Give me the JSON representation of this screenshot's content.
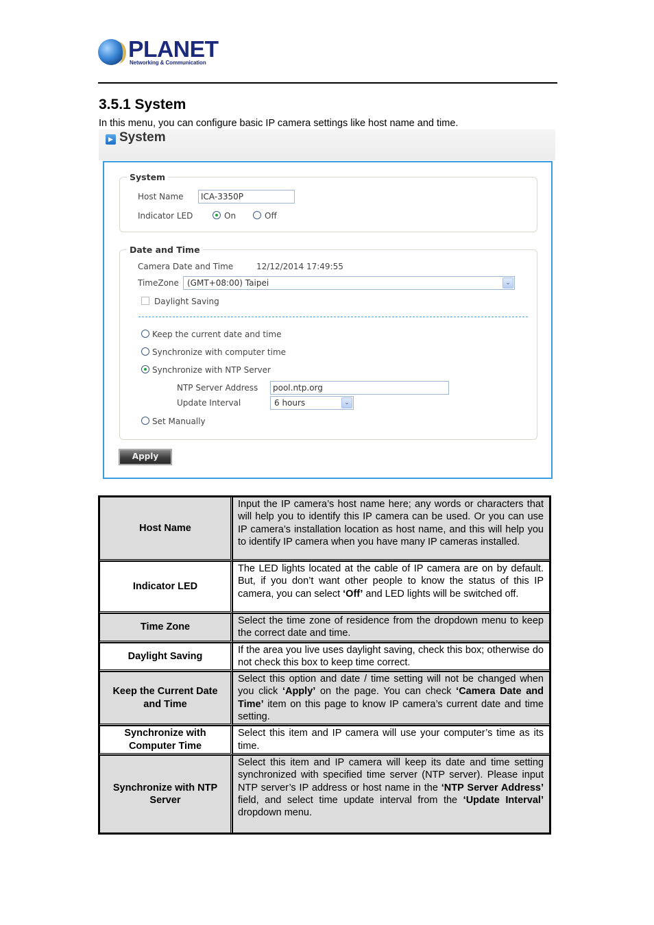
{
  "header": {
    "logo_word": "PLANET",
    "logo_tagline": "Networking & Communication"
  },
  "section": {
    "title": "3.5.1 System",
    "intro": "In this menu, you can configure basic IP camera settings like host name and time."
  },
  "panel": {
    "title": "System",
    "system_group": {
      "legend": "System",
      "host_name_label": "Host Name",
      "host_name_value": "ICA-3350P",
      "indicator_led_label": "Indicator LED",
      "led_options": [
        {
          "label": "On",
          "selected": true
        },
        {
          "label": "Off",
          "selected": false
        }
      ]
    },
    "date_time_group": {
      "legend": "Date and Time",
      "camera_date_label": "Camera Date and Time",
      "camera_date_value": "12/12/2014 17:49:55",
      "timezone_label": "TimeZone",
      "timezone_value": "(GMT+08:00) Taipei",
      "daylight_saving_label": "Daylight Saving",
      "daylight_saving_checked": false,
      "mode_options": [
        {
          "label": "Keep the current date and time",
          "selected": false
        },
        {
          "label": "Synchronize with computer time",
          "selected": false
        },
        {
          "label": "Synchronize with NTP Server",
          "selected": true
        },
        {
          "label": "Set Manually",
          "selected": false
        }
      ],
      "ntp_server_label": "NTP Server Address",
      "ntp_server_value": "pool.ntp.org",
      "update_interval_label": "Update Interval",
      "update_interval_value": "6 hours"
    },
    "apply_label": "Apply"
  },
  "table": {
    "rows": [
      {
        "key": "Host Name",
        "shaded": true,
        "parts": [
          {
            "t": "Input the IP camera’s host name here; any words or characters that will help you to identify this IP camera can be used. Or you can use IP camera’s installation location as host name, and this will help you to identify IP camera when you have many IP cameras installed."
          }
        ]
      },
      {
        "key": "Indicator LED",
        "shaded": false,
        "parts": [
          {
            "t": "The LED lights located at the cable of IP camera are on by default. But, if you don’t want other people to know the status of this IP camera, you can select "
          },
          {
            "t": "‘Off’",
            "b": true
          },
          {
            "t": " and LED lights will be switched off."
          }
        ]
      },
      {
        "key": "Time Zone",
        "shaded": true,
        "parts": [
          {
            "t": "Select the time zone of residence from the dropdown menu to keep the correct date and time."
          }
        ]
      },
      {
        "key": "Daylight Saving",
        "shaded": false,
        "parts": [
          {
            "t": "If the area you live uses daylight saving, check this box; otherwise do not check this box to keep time correct."
          }
        ]
      },
      {
        "key": "Keep the Current Date and Time",
        "shaded": true,
        "parts": [
          {
            "t": "Select this option and date / time setting will not be changed when you click "
          },
          {
            "t": "‘Apply’",
            "b": true
          },
          {
            "t": " on the page. You can check "
          },
          {
            "t": "‘Camera Date and Time’",
            "b": true
          },
          {
            "t": " item on this page to know IP camera’s current date and time setting."
          }
        ]
      },
      {
        "key": "Synchronize with Computer Time",
        "shaded": false,
        "parts": [
          {
            "t": "Select this item and IP camera will use your computer’s time as its time."
          }
        ]
      },
      {
        "key": "Synchronize with NTP Server",
        "shaded": true,
        "parts": [
          {
            "t": "Select this item and IP camera will keep its date and time setting synchronized with specified time server (NTP server). Please input NTP server’s IP address or host name in the "
          },
          {
            "t": "‘NTP Server Address’",
            "b": true
          },
          {
            "t": " field, and select time update interval from the "
          },
          {
            "t": "‘Update Interval’",
            "b": true
          },
          {
            "t": " dropdown menu."
          }
        ]
      }
    ]
  }
}
